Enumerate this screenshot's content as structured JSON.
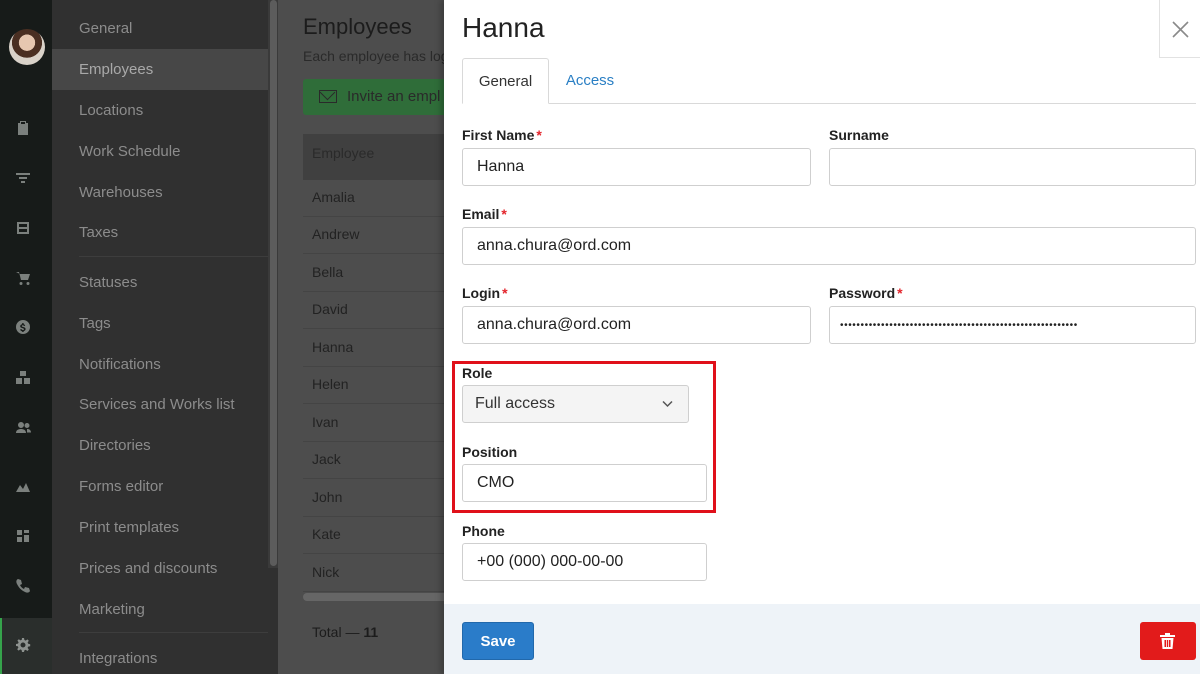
{
  "rail": {
    "icons": [
      "avatar",
      "clipboard-icon",
      "filter-icon",
      "inbox-icon",
      "cart-icon",
      "dollar-icon",
      "boxes-icon",
      "users-icon",
      "chart-icon",
      "dashboard-icon",
      "phone-icon",
      "gear-icon"
    ]
  },
  "nav": {
    "items": [
      {
        "label": "General"
      },
      {
        "label": "Employees"
      },
      {
        "label": "Locations"
      },
      {
        "label": "Work Schedule"
      },
      {
        "label": "Warehouses"
      },
      {
        "label": "Taxes"
      },
      {
        "label": "Statuses"
      },
      {
        "label": "Tags"
      },
      {
        "label": "Notifications"
      },
      {
        "label": "Services and Works list"
      },
      {
        "label": "Directories"
      },
      {
        "label": "Forms editor"
      },
      {
        "label": "Print templates"
      },
      {
        "label": "Prices and discounts"
      },
      {
        "label": "Marketing"
      },
      {
        "label": "Integrations"
      }
    ],
    "active": "Employees"
  },
  "employees": {
    "title": "Employees",
    "subtitle": "Each employee has log",
    "invite_label": "Invite an empl",
    "column_header": "Employee",
    "rows": [
      "Amalia",
      "Andrew",
      "Bella",
      "David",
      "Hanna",
      "Helen",
      "Ivan",
      "Jack",
      "John",
      "Kate",
      "Nick"
    ],
    "total_label": "Total —",
    "total_value": "11"
  },
  "drawer": {
    "title": "Hanna",
    "tabs": [
      {
        "label": "General"
      },
      {
        "label": "Access"
      }
    ],
    "active_tab": "General",
    "fields": {
      "first_name": {
        "label": "First Name",
        "value": "Hanna",
        "required": "*"
      },
      "surname": {
        "label": "Surname",
        "value": ""
      },
      "email": {
        "label": "Email",
        "value": "anna.chura@ord.com",
        "required": "*"
      },
      "login": {
        "label": "Login",
        "value": "anna.chura@ord.com",
        "required": "*"
      },
      "password": {
        "label": "Password",
        "value": "••••••••••••••••••••••••••••••••••••••••••••••••••••••••••",
        "required": "*"
      },
      "role": {
        "label": "Role",
        "value": "Full access"
      },
      "position": {
        "label": "Position",
        "value": "CMO"
      },
      "phone": {
        "label": "Phone",
        "value": "+00 (000) 000-00-00"
      }
    },
    "save_label": "Save",
    "highlight_color": "#e0101a",
    "accent_color": "#2a7cc9",
    "danger_color": "#e21b1b"
  }
}
